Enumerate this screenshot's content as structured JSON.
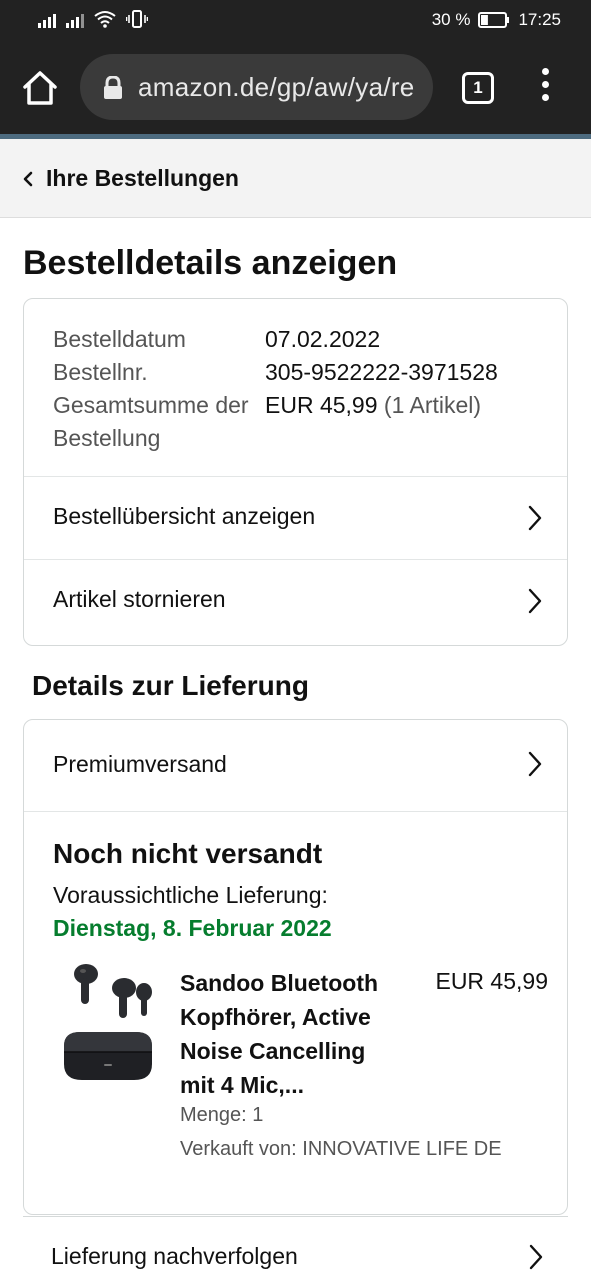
{
  "status_bar": {
    "battery_percent": "30 %",
    "time": "17:25",
    "icons": [
      "signal-icon",
      "signal-icon",
      "wifi-icon",
      "vibrate-icon",
      "battery-icon"
    ],
    "battery_level": 0.3
  },
  "browser": {
    "url": "amazon.de/gp/aw/ya/re",
    "tab_count": "1",
    "icons": [
      "home-icon",
      "lock-icon",
      "tabs-icon",
      "more-vert-icon"
    ],
    "accent_color": "#4d6b7f"
  },
  "breadcrumb": {
    "label": "Ihre Bestellungen",
    "icon": "chevron-left-icon"
  },
  "page": {
    "title": "Bestelldetails anzeigen"
  },
  "order_summary": {
    "date_label": "Bestelldatum",
    "date_value": "07.02.2022",
    "number_label": "Bestellnr.",
    "number_value": "305-9522222-3971528",
    "total_label": "Gesamtsumme der Bestellung",
    "total_value": "EUR 45,99",
    "total_items": "(1 Artikel)"
  },
  "order_links": [
    {
      "label": "Bestellübersicht anzeigen",
      "icon": "chevron-right-icon"
    },
    {
      "label": "Artikel stornieren",
      "icon": "chevron-right-icon"
    }
  ],
  "delivery": {
    "section_title": "Details zur Lieferung",
    "shipping_method": "Premiumversand",
    "status": "Noch nicht versandt",
    "eta_label": "Voraussichtliche Lieferung:",
    "eta_date": "Dienstag, 8. Februar 2022",
    "eta_color": "#067d2e",
    "track_label": "Lieferung nachverfolgen"
  },
  "product": {
    "title": "Sandoo Bluetooth Kopfhörer, Active Noise Cancelling mit 4 Mic,...",
    "price": "EUR 45,99",
    "quantity": "Menge: 1",
    "seller": "Verkauft von: INNOVATIVE LIFE DE",
    "image": "earbuds-image"
  }
}
